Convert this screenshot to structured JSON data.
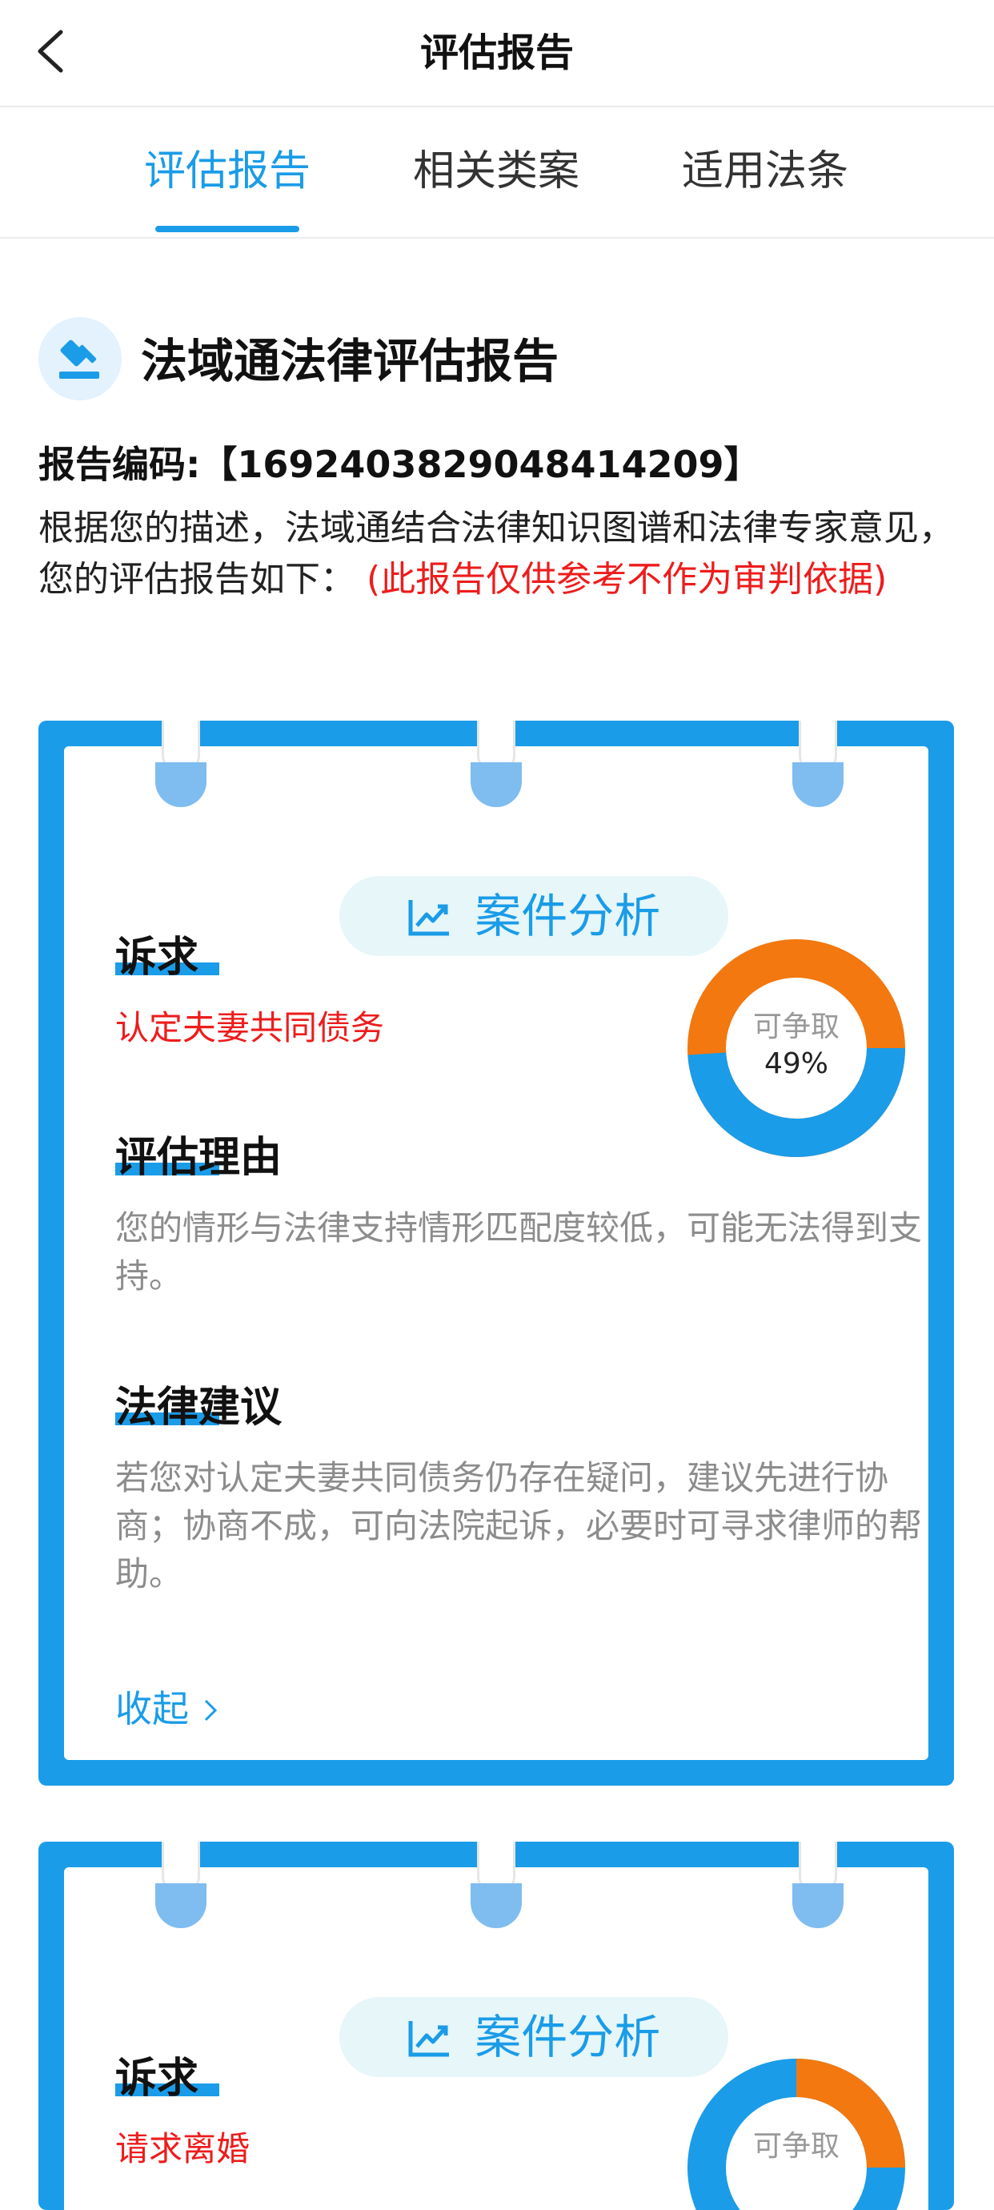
{
  "nav": {
    "title": "评估报告"
  },
  "tabs": [
    {
      "label": "评估报告",
      "active": true
    },
    {
      "label": "相关类案",
      "active": false
    },
    {
      "label": "适用法条",
      "active": false
    }
  ],
  "report": {
    "title": "法域通法律评估报告",
    "code": "报告编码:【1692403829048414209】",
    "intro": "根据您的描述，法域通结合法律知识图谱和法律专家意见，您的评估报告如下：",
    "warning": "(此报告仅供参考不作为审判依据)"
  },
  "cards": [
    {
      "badge": "案件分析",
      "claim_title": "诉求",
      "claim": "认定夫妻共同债务",
      "reason_title": "评估理由",
      "reason": "您的情形与法律支持情形匹配度较低，可能无法得到支持。",
      "advice_title": "法律建议",
      "advice": "若您对认定夫妻共同债务仍存在疑问，建议先进行协商；协商不成，可向法院起诉，必要时可寻求律师的帮助。",
      "collapse": "收起",
      "donut": {
        "label": "可争取",
        "percent": 49,
        "percent_text": "49%",
        "fill_color": "#1a9ce8",
        "rest_color": "#f2780f"
      }
    },
    {
      "badge": "案件分析",
      "claim_title": "诉求",
      "claim": "请求离婚",
      "donut": {
        "label": "可争取",
        "fill_color": "#1a9ce8",
        "rest_color": "#f2780f"
      }
    }
  ],
  "colors": {
    "accent": "#1a9ce8",
    "warning": "#ee1c1c",
    "orange": "#f2780f"
  }
}
